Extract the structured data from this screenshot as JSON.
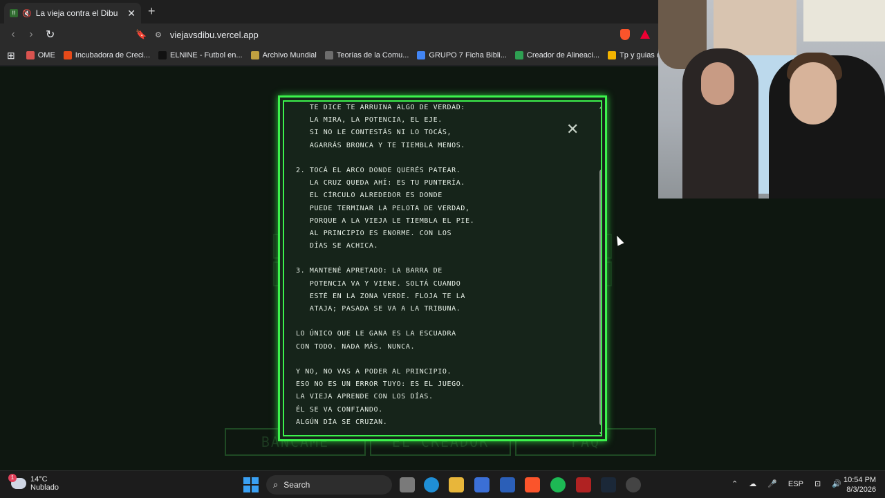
{
  "browser": {
    "tab_title": "La vieja contra el Dibu",
    "url": "viejavsdibu.vercel.app",
    "bookmarks": [
      {
        "label": "OME",
        "color": "#d9534f"
      },
      {
        "label": "Incubadora de Creci...",
        "color": "#e64a19"
      },
      {
        "label": "ELNINE - Futbol en...",
        "color": "#111111"
      },
      {
        "label": "Archivo Mundial",
        "color": "#c0a040"
      },
      {
        "label": "Teorías de la Comu...",
        "color": "#6d6d6d"
      },
      {
        "label": "GRUPO 7 Ficha Bibli...",
        "color": "#4285f4"
      },
      {
        "label": "Creador de Alineaci...",
        "color": "#2e9f52"
      },
      {
        "label": "Tp y guias de lectur...",
        "color": "#f4b400"
      }
    ]
  },
  "modal": {
    "lines": [
      "   TE DICE TE ARRUINA ALGO DE VERDAD:",
      "   LA MIRA, LA POTENCIA, EL EJE.",
      "   SI NO LE CONTESTÁS NI LO TOCÁS,",
      "   AGARRÁS BRONCA Y TE TIEMBLA MENOS.",
      "",
      "2. TOCÁ EL ARCO DONDE QUERÉS PATEAR.",
      "   LA CRUZ QUEDA AHÍ: ES TU PUNTERÍA.",
      "   EL CÍRCULO ALREDEDOR ES DONDE",
      "   PUEDE TERMINAR LA PELOTA DE VERDAD,",
      "   PORQUE A LA VIEJA LE TIEMBLA EL PIE.",
      "   AL PRINCIPIO ES ENORME. CON LOS",
      "   DÍAS SE ACHICA.",
      "",
      "3. MANTENÉ APRETADO: LA BARRA DE",
      "   POTENCIA VA Y VIENE. SOLTÁ CUANDO",
      "   ESTÉ EN LA ZONA VERDE. FLOJA TE LA",
      "   ATAJA; PASADA SE VA A LA TRIBUNA.",
      "",
      "LO ÚNICO QUE LE GANA ES LA ESCUADRA",
      "CON TODO. NADA MÁS. NUNCA.",
      "",
      "Y NO, NO VAS A PODER AL PRINCIPIO.",
      "ESO NO ES UN ERROR TUYO: ES EL JUEGO.",
      "LA VIEJA APRENDE CON LOS DÍAS.",
      "ÉL SE VA CONFIANDO.",
      "ALGÚN DÍA SE CRUZAN."
    ],
    "close_glyph": "✕",
    "accent": "#3cf24c",
    "scroll_position": 0.2
  },
  "background_buttons": [
    "BANCAME",
    "EL CREADOR",
    "FAQ"
  ],
  "taskbar": {
    "weather_temp": "14°C",
    "weather_desc": "Nublado",
    "weather_badge": "1",
    "search_label": "Search",
    "lang": "ESP",
    "time": "10:54 PM",
    "date": "8/3/2026"
  }
}
